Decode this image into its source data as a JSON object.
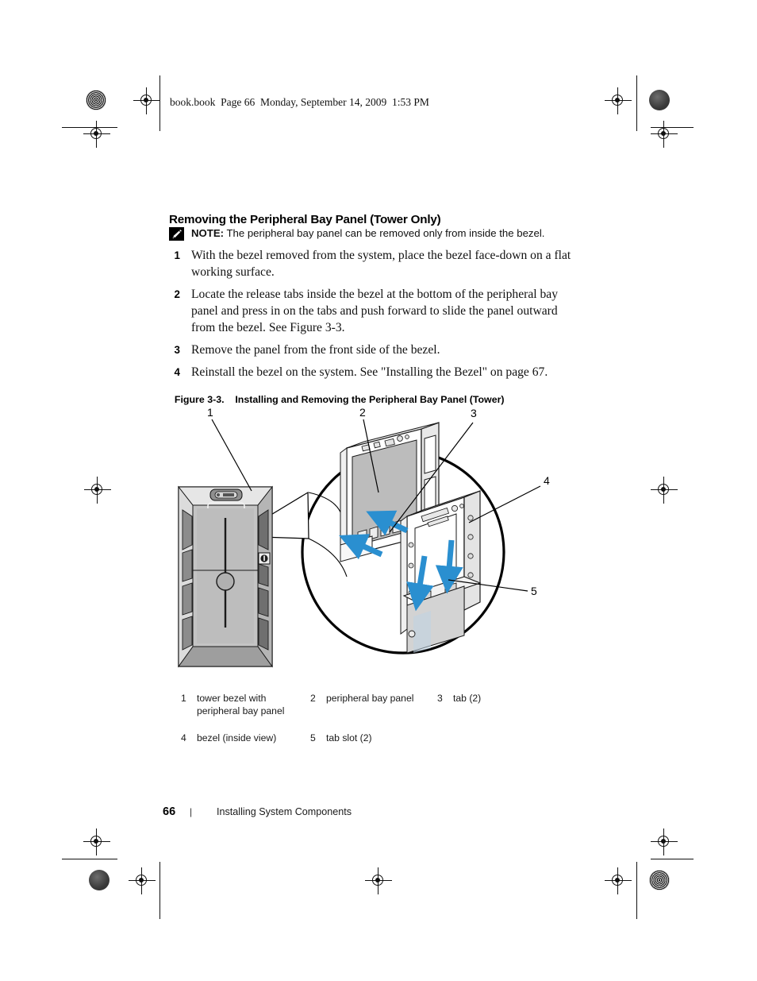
{
  "header": {
    "slug": "book.book  Page 66  Monday, September 14, 2009  1:53 PM"
  },
  "content": {
    "title": "Removing the Peripheral Bay Panel (Tower Only)",
    "note_label": "NOTE:",
    "note_text": " The peripheral bay panel can be removed only from inside the bezel.",
    "note_icon": "note-pencil-icon",
    "steps": [
      {
        "num": "1",
        "text": "With the bezel removed from the system, place the bezel face-down on a flat working surface."
      },
      {
        "num": "2",
        "text": "Locate the release tabs inside the bezel at the bottom of the peripheral bay panel and press in on the tabs and push forward to slide the panel outward from the bezel. See Figure 3-3."
      },
      {
        "num": "3",
        "text": "Remove the panel from the front side of the bezel."
      },
      {
        "num": "4",
        "text": "Reinstall the bezel on the system. See \"Installing the Bezel\" on page 67."
      }
    ]
  },
  "figure": {
    "label": "Figure 3-3.",
    "caption": "Installing and Removing the Peripheral Bay Panel (Tower)",
    "callouts": [
      "1",
      "2",
      "3",
      "4",
      "5"
    ],
    "arrow_color": "#2a8fd0",
    "legend": [
      {
        "key": "1",
        "value": "tower bezel with peripheral bay panel"
      },
      {
        "key": "2",
        "value": "peripheral bay panel"
      },
      {
        "key": "3",
        "value": "tab (2)"
      },
      {
        "key": "4",
        "value": "bezel (inside view)"
      },
      {
        "key": "5",
        "value": "tab slot (2)"
      }
    ]
  },
  "footer": {
    "page_number": "66",
    "separator": "|",
    "section": "Installing System Components"
  }
}
